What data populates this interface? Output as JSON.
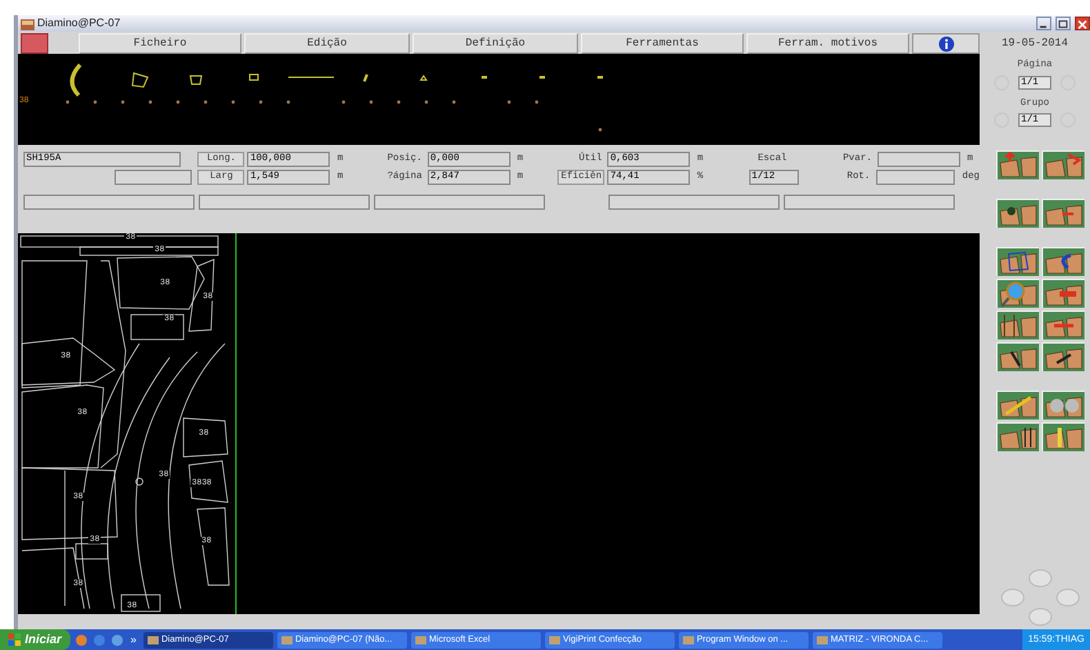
{
  "window": {
    "title": "Diamino@PC-07"
  },
  "menu": [
    "Ficheiro",
    "Edição",
    "Definição",
    "Ferramentas",
    "Ferram. motivos"
  ],
  "side": {
    "date": "19-05-2014",
    "page": {
      "label": "Página",
      "value": "1/1"
    },
    "group": {
      "label": "Grupo",
      "value": "1/1"
    }
  },
  "strip": {
    "label": "38"
  },
  "info": {
    "groups": [
      {
        "rows": [
          {
            "value": "SH195A"
          },
          {
            "value": ""
          }
        ]
      },
      {
        "rows": [
          {
            "label": "Long.",
            "kind": "button",
            "value": "100,000",
            "unit": "m"
          },
          {
            "label": "Larg",
            "kind": "button",
            "value": "1,549",
            "unit": "m"
          }
        ]
      },
      {
        "rows": [
          {
            "label": "Posiç.",
            "kind": "text",
            "value": "0,000",
            "unit": "m"
          },
          {
            "label": "?ágina",
            "kind": "text",
            "value": "2,847",
            "unit": "m"
          }
        ]
      },
      {
        "rows": [
          {
            "label": "Útil",
            "kind": "text",
            "value": "0,603",
            "unit": "m"
          },
          {
            "label": "Eficiên",
            "kind": "button",
            "value": "74,41",
            "unit": "%"
          }
        ]
      },
      {
        "rows": [
          {
            "label": "Escal",
            "kind": "text"
          },
          {
            "value": "1/12"
          }
        ]
      },
      {
        "rows": [
          {
            "label": "Pvar.",
            "kind": "text",
            "value": "",
            "unit": "m"
          },
          {
            "label": "Rot.",
            "kind": "text",
            "value": "",
            "unit": "deg"
          }
        ]
      }
    ]
  },
  "marker": {
    "labels": [
      "38",
      "38",
      "38",
      "38",
      "38",
      "38",
      "38",
      "38",
      "38",
      "3838",
      "38",
      "38",
      "38",
      "38",
      "38"
    ]
  },
  "taskbar": {
    "start": "Iniciar",
    "more": "»",
    "tasks": [
      {
        "label": "Diamino@PC-07",
        "selected": true
      },
      {
        "label": "Diamino@PC-07 (Não...",
        "selected": false
      },
      {
        "label": "Microsoft Excel",
        "selected": false
      },
      {
        "label": "VigiPrint Confecção",
        "selected": false
      },
      {
        "label": "Program Window on ...",
        "selected": false
      },
      {
        "label": "MATRIZ - VIRONDA C...",
        "selected": false
      }
    ],
    "clock": "15:59:THIAG"
  }
}
